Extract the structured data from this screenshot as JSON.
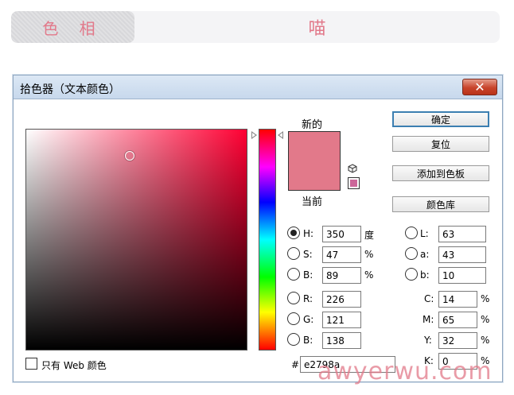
{
  "banner": {
    "tag": "色 相",
    "title": "喵"
  },
  "dialog": {
    "title": "拾色器（文本颜色）",
    "close_glyph": "✕",
    "new_label": "新的",
    "current_label": "当前",
    "new_color": "#e2798a",
    "current_color": "#e2798a",
    "websafe_color": "#cc6699",
    "buttons": {
      "ok": "确定",
      "reset": "复位",
      "add_to_swatches": "添加到色板",
      "color_libraries": "颜色库"
    },
    "hsb": {
      "h": {
        "label": "H:",
        "value": "350",
        "unit": "度",
        "selected": true
      },
      "s": {
        "label": "S:",
        "value": "47",
        "unit": "%"
      },
      "b": {
        "label": "B:",
        "value": "89",
        "unit": "%"
      }
    },
    "rgb": {
      "r": {
        "label": "R:",
        "value": "226"
      },
      "g": {
        "label": "G:",
        "value": "121"
      },
      "b": {
        "label": "B:",
        "value": "138"
      }
    },
    "lab": {
      "l": {
        "label": "L:",
        "value": "63"
      },
      "a": {
        "label": "a:",
        "value": "43"
      },
      "b": {
        "label": "b:",
        "value": "10"
      }
    },
    "cmyk": {
      "c": {
        "label": "C:",
        "value": "14",
        "unit": "%"
      },
      "m": {
        "label": "M:",
        "value": "65",
        "unit": "%"
      },
      "y": {
        "label": "Y:",
        "value": "32",
        "unit": "%"
      },
      "k": {
        "label": "K:",
        "value": "0",
        "unit": "%"
      }
    },
    "hex": {
      "label": "#",
      "value": "e2798a"
    },
    "web_only_label": "只有 Web 颜色"
  },
  "watermark": "awyerwu.com"
}
